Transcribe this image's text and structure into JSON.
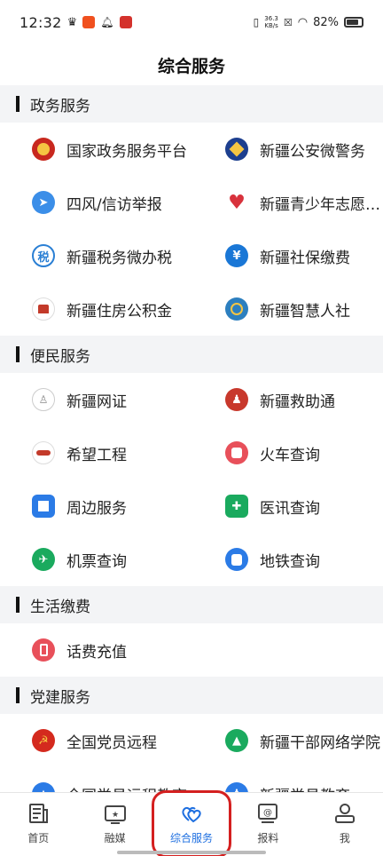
{
  "status": {
    "time": "12:32",
    "speed_value": "36.3",
    "speed_unit": "KB/s",
    "battery": "82%"
  },
  "header": {
    "title": "综合服务"
  },
  "sections": [
    {
      "title": "政务服务",
      "items": [
        {
          "label": "国家政务服务平台",
          "icon": "national-emblem-icon",
          "color": "#c8281e",
          "glyph": ""
        },
        {
          "label": "新疆公安微警务",
          "icon": "police-badge-icon",
          "color": "#1d3f8f",
          "glyph": ""
        },
        {
          "label": "四风/信访举报",
          "icon": "paper-plane-icon",
          "color": "#3b8ee8",
          "glyph": ""
        },
        {
          "label": "新疆青少年志愿…",
          "icon": "heart-icon",
          "color": "#d8323c",
          "glyph": ""
        },
        {
          "label": "新疆税务微办税",
          "icon": "tax-icon",
          "color": "#2a7fd4",
          "glyph": "税"
        },
        {
          "label": "新疆社保缴费",
          "icon": "yuan-coin-icon",
          "color": "#1a77d6",
          "glyph": "¥"
        },
        {
          "label": "新疆住房公积金",
          "icon": "housing-fund-icon",
          "color": "#c33a2a",
          "glyph": ""
        },
        {
          "label": "新疆智慧人社",
          "icon": "globe-emblem-icon",
          "color": "#2c7fbf",
          "glyph": ""
        }
      ]
    },
    {
      "title": "便民服务",
      "items": [
        {
          "label": "新疆网证",
          "icon": "id-person-icon",
          "color": "#ffffff",
          "glyph": ""
        },
        {
          "label": "新疆救助通",
          "icon": "rescue-people-icon",
          "color": "#c8382c",
          "glyph": ""
        },
        {
          "label": "希望工程",
          "icon": "hope-project-icon",
          "color": "#ffffff",
          "glyph": ""
        },
        {
          "label": "火车查询",
          "icon": "train-icon",
          "color": "#e8505a",
          "glyph": ""
        },
        {
          "label": "周边服务",
          "icon": "blocks-icon",
          "color": "#2b7be6",
          "glyph": ""
        },
        {
          "label": "医讯查询",
          "icon": "medical-shield-icon",
          "color": "#1aaa5e",
          "glyph": ""
        },
        {
          "label": "机票查询",
          "icon": "airplane-icon",
          "color": "#1aaa5e",
          "glyph": ""
        },
        {
          "label": "地铁查询",
          "icon": "subway-icon",
          "color": "#2b7be6",
          "glyph": ""
        }
      ]
    },
    {
      "title": "生活缴费",
      "items": [
        {
          "label": "话费充值",
          "icon": "phone-icon",
          "color": "#e8505a",
          "glyph": ""
        }
      ]
    },
    {
      "title": "党建服务",
      "items": [
        {
          "label": "全国党员远程",
          "icon": "party-emblem-icon",
          "color": "#d42a1e",
          "glyph": ""
        },
        {
          "label": "新疆干部网络学院",
          "icon": "graduation-cap-icon",
          "color": "#1aaa5e",
          "glyph": ""
        },
        {
          "label": "全国党员远程教育",
          "icon": "education-icon",
          "color": "#2b7be6",
          "glyph": ""
        },
        {
          "label": "新疆党员教育",
          "icon": "people-icon",
          "color": "#2b7be6",
          "glyph": ""
        }
      ]
    }
  ],
  "tabs": [
    {
      "label": "首页",
      "icon": "newspaper-icon"
    },
    {
      "label": "融媒",
      "icon": "tv-star-icon"
    },
    {
      "label": "综合服务",
      "icon": "hearts-icon",
      "active": true
    },
    {
      "label": "报料",
      "icon": "at-box-icon"
    },
    {
      "label": "我",
      "icon": "person-icon"
    }
  ]
}
